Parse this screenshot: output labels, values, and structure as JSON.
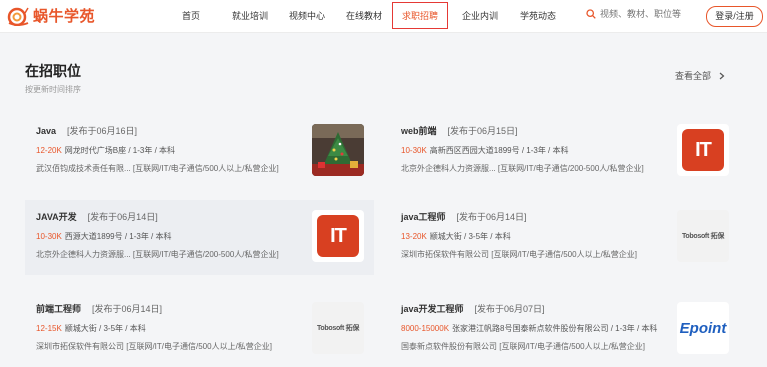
{
  "brand": {
    "name": "蜗牛学苑"
  },
  "nav": [
    {
      "label": "首页"
    },
    {
      "label": "就业培训"
    },
    {
      "label": "视频中心"
    },
    {
      "label": "在线教材"
    },
    {
      "label": "求职招聘",
      "active": true
    },
    {
      "label": "企业内训"
    },
    {
      "label": "学苑动态"
    }
  ],
  "search": {
    "placeholder": "视频、教材、职位等"
  },
  "login": {
    "label": "登录/注册"
  },
  "section": {
    "title": "在招职位",
    "subtitle": "按更新时间排序",
    "view_all": "查看全部"
  },
  "jobs": [
    {
      "title": "Java",
      "date": "[发布于06月16日]",
      "salary": "12-20K",
      "details": "网龙时代广场B座 / 1-3年 / 本科",
      "company": "武汉佰钧成技术责任有限...",
      "tags": "[互联网/IT/电子通信/500人以上/私营企业]",
      "logo": "xmas-photo"
    },
    {
      "title": "web前端",
      "date": "[发布于06月15日]",
      "salary": "10-30K",
      "details": "高新西区西园大道1899号 / 1-3年 / 本科",
      "company": "北京外企德科人力资源服...",
      "tags": "[互联网/IT/电子通信/200-500人/私营企业]",
      "logo": "IT"
    },
    {
      "title": "JAVA开发",
      "date": "[发布于06月14日]",
      "salary": "10-30K",
      "details": "西源大道1899号 / 1-3年 / 本科",
      "company": "北京外企德科人力资源服...",
      "tags": "[互联网/IT/电子通信/200-500人/私营企业]",
      "logo": "IT"
    },
    {
      "title": "java工程师",
      "date": "[发布于06月14日]",
      "salary": "13-20K",
      "details": "颛城大街 / 3-5年 / 本科",
      "company": "深圳市拓保软件有限公司",
      "tags": "[互联网/IT/电子通信/500人以上/私营企业]",
      "logo": "tobosoft"
    },
    {
      "title": "前端工程师",
      "date": "[发布于06月14日]",
      "salary": "12-15K",
      "details": "颛城大街 / 3-5年 / 本科",
      "company": "深圳市拓保软件有限公司",
      "tags": "[互联网/IT/电子通信/500人以上/私营企业]",
      "logo": "tobosoft"
    },
    {
      "title": "java开发工程师",
      "date": "[发布于06月07日]",
      "salary": "8000-15000K",
      "details": "张家港江帆路8号国泰新点软件股份有限公司 / 1-3年 / 本科",
      "company": "国泰新点软件股份有限公司",
      "tags": "[互联网/IT/电子通信/500人以上/私营企业]",
      "logo": "Epoint"
    }
  ],
  "logo_text": {
    "it": "IT",
    "tobosoft": "Tobosoft 拓保",
    "epoint": "Epoint"
  },
  "colors": {
    "accent": "#e8562a",
    "highlight_border": "#e53935",
    "it_logo": "#d84021",
    "epoint": "#1f5fbf"
  }
}
